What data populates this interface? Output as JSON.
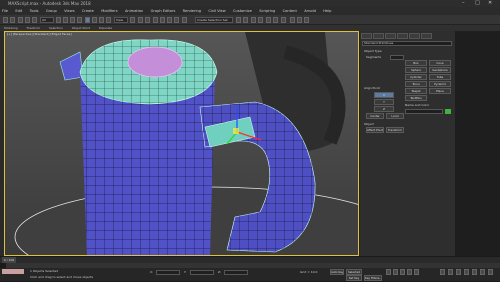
{
  "window": {
    "title": "MAXScript.max - Autodesk 3ds Max 2018",
    "controls": [
      "–",
      "□",
      "✕"
    ]
  },
  "menubar": {
    "items": [
      "File",
      "Edit",
      "Tools",
      "Group",
      "Views",
      "Create",
      "Modifiers",
      "Animation",
      "Graph Editors",
      "Rendering",
      "Civil View",
      "Customize",
      "Scripting",
      "Content",
      "Arnold",
      "Help"
    ]
  },
  "toolbar": {
    "view_dropdown": "View",
    "selection_set_dropdown": "Create Selection Set"
  },
  "ribbon": {
    "tabs": [
      "Modeling",
      "Freeform",
      "Selection",
      "Object Paint",
      "Populate"
    ]
  },
  "viewport": {
    "label": "[+] [Perspective] [Standard] [Edged Faces]"
  },
  "command_panel": {
    "title": "Standard Primitives",
    "rollout_object_type": "Object Type",
    "autogrid_label": "AutoGrid",
    "primitives": [
      "Box",
      "Cone",
      "Sphere",
      "GeoSphere",
      "Cylinder",
      "Tube",
      "Torus",
      "Pyramid",
      "Teapot",
      "Plane",
      "TextPlus"
    ],
    "rollout_name_color": "Name and Color",
    "segments_label": "Segments",
    "parameters_label": "Align Pivot",
    "checkbox_labels": [
      "X",
      "Y",
      "Z",
      "Pivot",
      "Center",
      "Local",
      "World"
    ],
    "object_label": "Object",
    "pivot_buttons": [
      "Affect Pivot",
      "Transform"
    ]
  },
  "timeline": {
    "frame_readout": "0 / 100",
    "ticks": [
      "0",
      "5",
      "10",
      "15",
      "20",
      "25",
      "30",
      "35",
      "40",
      "45",
      "50",
      "55",
      "60",
      "65",
      "70",
      "75",
      "80",
      "85",
      "90",
      "95",
      "100"
    ]
  },
  "statusbar": {
    "selection": "1 Objects Selected",
    "prompt": "Click and drag to select and move objects",
    "coord_x_label": "X:",
    "coord_y_label": "Y:",
    "coord_z_label": "Z:",
    "grid": "Grid = 10.0",
    "autokey": "Auto Key",
    "selected_dropdown": "Selected",
    "setkey": "Set Key",
    "keyfilters": "Key Filters..."
  }
}
